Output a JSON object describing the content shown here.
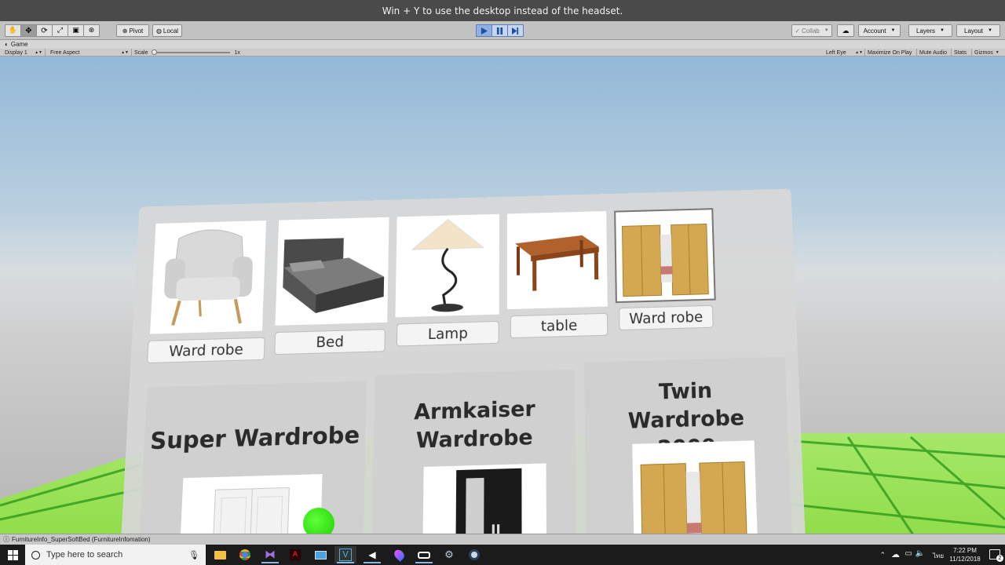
{
  "vr_banner": {
    "text": "Win + Y to use the desktop instead of the headset."
  },
  "toolbar": {
    "pivot_label": "Pivot",
    "local_label": "Local",
    "collab_label": "Collab",
    "account_label": "Account",
    "layers_label": "Layers",
    "layout_label": "Layout"
  },
  "game_tab": {
    "label": "Game"
  },
  "game_bar": {
    "display": "Display 1",
    "aspect": "Free Aspect",
    "scale_label": "Scale",
    "scale_value": "1x",
    "eye": "Left Eye",
    "maximize": "Maximize On Play",
    "mute": "Mute Audio",
    "stats": "Stats",
    "gizmos": "Gizmos"
  },
  "panel": {
    "thumbnails": [
      {
        "label": "Ward robe",
        "icon": "armchair-image"
      },
      {
        "label": "Bed",
        "icon": "bed-image"
      },
      {
        "label": "Lamp",
        "icon": "lamp-image"
      },
      {
        "label": "table",
        "icon": "table-image"
      },
      {
        "label": "Ward robe",
        "icon": "wardrobe-image"
      }
    ],
    "cards": [
      {
        "title": "Super Wardrobe"
      },
      {
        "title": "Armkaiser Wardrobe"
      },
      {
        "title": "Twin Wardrobe 2009"
      }
    ]
  },
  "status_bar": {
    "text": "FurnitureInfo_SuperSoftBed (FurnitureInfomation)"
  },
  "taskbar": {
    "search_placeholder": "Type here to search",
    "time": "7:22 PM",
    "date": "11/12/2018",
    "lang": "ไทย",
    "notification_count": "2"
  },
  "colors": {
    "ground": "#a6e86a",
    "play_blue": "#8fb0e0",
    "green_dot": "#1ed000"
  }
}
